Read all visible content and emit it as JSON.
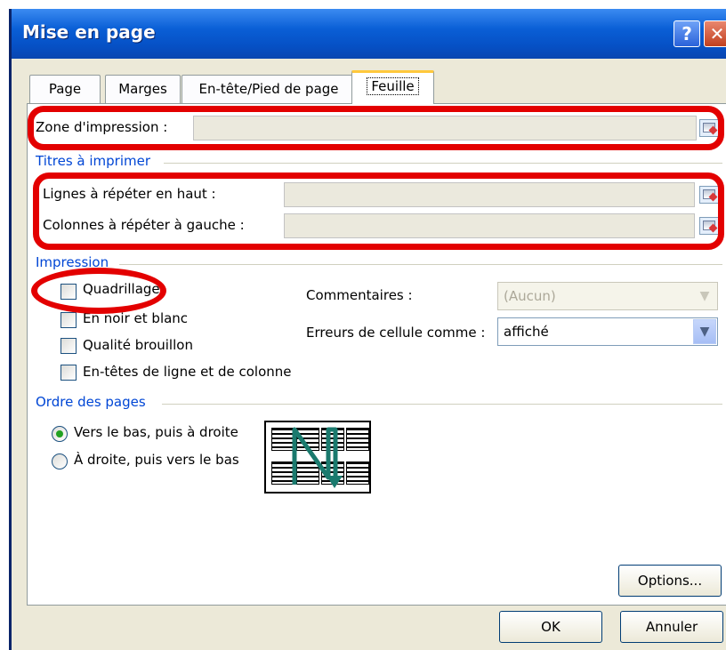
{
  "window": {
    "title": "Mise en page",
    "help_button": "?",
    "close_button": "✕"
  },
  "tabs": [
    {
      "label": "Page",
      "active": false
    },
    {
      "label": "Marges",
      "active": false
    },
    {
      "label": "En-tête/Pied de page",
      "active": false
    },
    {
      "label": "Feuille",
      "active": true
    }
  ],
  "print_area": {
    "label": "Zone d'impression :",
    "value": ""
  },
  "print_titles": {
    "group_title": "Titres à imprimer",
    "rows_label": "Lignes à répéter en haut :",
    "rows_value": "",
    "columns_label": "Colonnes à répéter à gauche :",
    "columns_value": ""
  },
  "print": {
    "group_title": "Impression",
    "checkboxes": [
      {
        "label": "Quadrillage",
        "checked": false
      },
      {
        "label": "En noir et blanc",
        "checked": false
      },
      {
        "label": "Qualité brouillon",
        "checked": false
      },
      {
        "label": "En-têtes de ligne et de colonne",
        "checked": false
      }
    ],
    "comments_label": "Commentaires :",
    "comments_value": "(Aucun)",
    "cell_errors_label": "Erreurs de cellule comme :",
    "cell_errors_value": "affiché"
  },
  "page_order": {
    "group_title": "Ordre des pages",
    "options": [
      {
        "label": "Vers le bas, puis à droite",
        "selected": true
      },
      {
        "label": "À droite, puis vers le bas",
        "selected": false
      }
    ]
  },
  "buttons": {
    "options": "Options...",
    "ok": "OK",
    "cancel": "Annuler"
  },
  "colors": {
    "highlight": "#e30000",
    "group_title": "#0046d5",
    "title_bar": "#0a5fd6",
    "arrow": "#1a7a6e"
  }
}
